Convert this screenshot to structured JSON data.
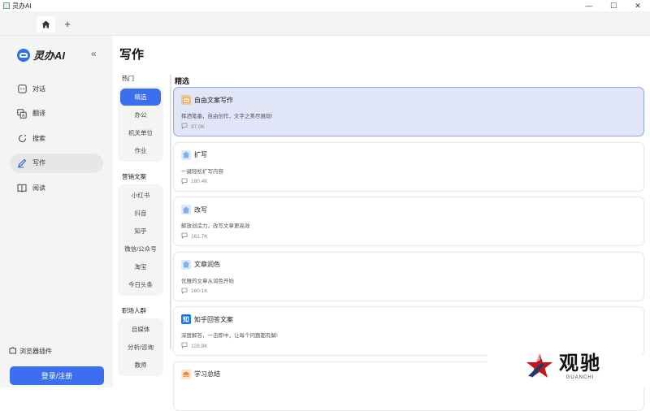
{
  "window": {
    "title": "灵办AI",
    "controls": [
      "—",
      "☐",
      "✕"
    ]
  },
  "tabs": {
    "home_icon": "home-icon",
    "add_label": "+"
  },
  "sidebar": {
    "brand": "灵办AI",
    "collapse_glyph": "«",
    "items": [
      {
        "label": "对话",
        "icon": "chat-icon"
      },
      {
        "label": "翻译",
        "icon": "translate-icon"
      },
      {
        "label": "搜索",
        "icon": "search-icon"
      },
      {
        "label": "写作",
        "icon": "pen-icon",
        "active": true
      },
      {
        "label": "阅读",
        "icon": "book-icon"
      }
    ],
    "plugin_label": "浏览器插件",
    "login_label": "登录/注册"
  },
  "page": {
    "title": "写作",
    "section_title": "精选"
  },
  "categories": [
    {
      "head": "热门",
      "items": [
        "精选",
        "办公",
        "机关单位",
        "作业"
      ],
      "active": 0
    },
    {
      "head": "营销文案",
      "items": [
        "小红书",
        "抖音",
        "知乎",
        "微信/公众号",
        "淘宝",
        "今日头条"
      ]
    },
    {
      "head": "职场人群",
      "items": [
        "自媒体",
        "分析/咨询",
        "教师"
      ]
    }
  ],
  "cards": [
    {
      "name": "自由文案写作",
      "desc": "挥洒笔墨，自由创作，文字之美尽展现!",
      "count": "97.0K",
      "icon": "free-write-icon",
      "active": true
    },
    {
      "name": "扩写",
      "desc": "一键轻松扩写内容",
      "count": "180.4K",
      "icon": "expand-icon"
    },
    {
      "name": "改写",
      "desc": "解放创造力，改写文章更高效",
      "count": "161.7K",
      "icon": "rewrite-icon"
    },
    {
      "name": "文章润色",
      "desc": "优雅的文章从润色开始",
      "count": "160.1K",
      "icon": "polish-icon"
    },
    {
      "name": "知乎回答文案",
      "desc": "深度解答，一击即中，让每个问题都有解!",
      "count": "128.8K",
      "icon": "zhihu-icon"
    },
    {
      "name": "学习总结",
      "desc": "",
      "count": "",
      "icon": "summary-icon"
    }
  ],
  "watermark": {
    "cn": "观驰",
    "en": "GUANCHI"
  },
  "colors": {
    "accent": "#3b6ff0",
    "active_card_bg": "#e0e6f8",
    "sidebar_bg": "#f4f4f5"
  }
}
